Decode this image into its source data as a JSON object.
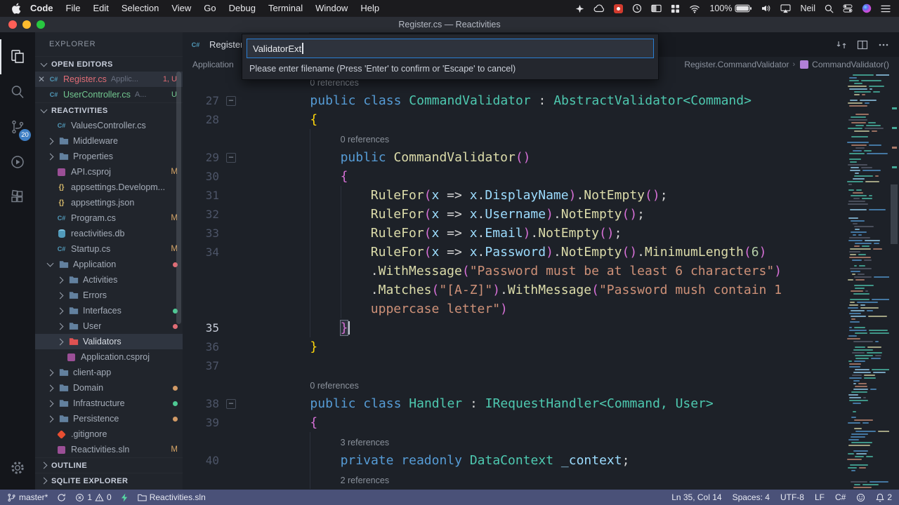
{
  "menubar": {
    "items": [
      "Code",
      "File",
      "Edit",
      "Selection",
      "View",
      "Go",
      "Debug",
      "Terminal",
      "Window",
      "Help"
    ],
    "status": {
      "battery_pct": "100%",
      "user": "Neil"
    },
    "status_icons": [
      "sparkle-icon",
      "cloud-icon",
      "red-app-icon",
      "clock-icon",
      "window-manager-icon",
      "grid-icon",
      "wifi-icon",
      "battery-icon",
      "volume-icon",
      "airplay-icon",
      "user-name",
      "search-icon",
      "control-center-icon",
      "siri-icon",
      "menu-list-icon"
    ]
  },
  "titlebar": {
    "title": "Register.cs — Reactivities"
  },
  "activitybar": {
    "scm_badge": "20"
  },
  "sidebar": {
    "header": "EXPLORER",
    "open_editors": {
      "header": "OPEN EDITORS",
      "items": [
        {
          "name": "Register.cs",
          "detail": "Applic...",
          "badge": "1, U",
          "color": "red",
          "active": true,
          "icon": "cs"
        },
        {
          "name": "UserController.cs",
          "detail": "A...",
          "badge": "U",
          "color": "green",
          "active": false,
          "icon": "cs"
        }
      ]
    },
    "project": {
      "header": "REACTIVITIES",
      "items": [
        {
          "icon": "cs",
          "label": "ValuesController.cs",
          "lvl": 0
        },
        {
          "icon": "folder",
          "chev": "r",
          "label": "Middleware",
          "lvl": 0
        },
        {
          "icon": "folder",
          "chev": "r",
          "label": "Properties",
          "lvl": 0
        },
        {
          "icon": "csproj",
          "label": "API.csproj",
          "lvl": 0,
          "badge": "M"
        },
        {
          "icon": "json",
          "label": "appsettings.Developm...",
          "lvl": 0
        },
        {
          "icon": "json",
          "label": "appsettings.json",
          "lvl": 0
        },
        {
          "icon": "cs",
          "label": "Program.cs",
          "lvl": 0,
          "badge": "M"
        },
        {
          "icon": "db",
          "label": "reactivities.db",
          "lvl": 0
        },
        {
          "icon": "cs",
          "label": "Startup.cs",
          "lvl": 0,
          "badge": "M"
        },
        {
          "icon": "folder",
          "chev": "d",
          "label": "Application",
          "lvl": 0,
          "dot": "red"
        },
        {
          "icon": "folder",
          "chev": "r",
          "label": "Activities",
          "lvl": 1
        },
        {
          "icon": "folder",
          "chev": "r",
          "label": "Errors",
          "lvl": 1
        },
        {
          "icon": "folder",
          "chev": "r",
          "label": "Interfaces",
          "lvl": 1,
          "dot": "green"
        },
        {
          "icon": "folder",
          "chev": "r",
          "label": "User",
          "lvl": 1,
          "dot": "red"
        },
        {
          "icon": "folder-red",
          "chev": "r",
          "label": "Validators",
          "lvl": 1,
          "selected": true
        },
        {
          "icon": "csproj",
          "label": "Application.csproj",
          "lvl": 1
        },
        {
          "icon": "folder",
          "chev": "r",
          "label": "client-app",
          "lvl": 0
        },
        {
          "icon": "folder",
          "chev": "r",
          "label": "Domain",
          "lvl": 0,
          "dot": "yellow"
        },
        {
          "icon": "folder",
          "chev": "r",
          "label": "Infrastructure",
          "lvl": 0,
          "dot": "green"
        },
        {
          "icon": "folder",
          "chev": "r",
          "label": "Persistence",
          "lvl": 0,
          "dot": "yellow"
        },
        {
          "icon": "git",
          "label": ".gitignore",
          "lvl": 0
        },
        {
          "icon": "sln",
          "label": "Reactivities.sln",
          "lvl": 0,
          "badge": "M"
        }
      ]
    },
    "outline_header": "OUTLINE",
    "sqlite_header": "SQLITE EXPLORER"
  },
  "quick_input": {
    "value": "ValidatorExt",
    "prompt": "Please enter filename (Press 'Enter' to confirm or 'Escape' to cancel)"
  },
  "editor": {
    "tab": {
      "label": "Register.cs"
    },
    "breadcrumbs": {
      "left": "Application",
      "type_path": "Register.CommandValidator",
      "symbol": "CommandValidator()"
    },
    "code": {
      "rows": [
        {
          "lens": "0 references",
          "ind": 8
        },
        {
          "n": "27",
          "fold": true,
          "ind": 8,
          "t": [
            [
              "k",
              "public class "
            ],
            [
              "ty",
              "CommandValidator"
            ],
            [
              "pl",
              " : "
            ],
            [
              "ty",
              "AbstractValidator<Command>"
            ]
          ]
        },
        {
          "n": "28",
          "ind": 8,
          "t": [
            [
              "b1",
              "{"
            ]
          ]
        },
        {
          "lens": "0 references",
          "ind": 12,
          "g": [
            8
          ]
        },
        {
          "n": "29",
          "fold": true,
          "ind": 12,
          "g": [
            8
          ],
          "t": [
            [
              "k",
              "public "
            ],
            [
              "fn",
              "CommandValidator"
            ],
            [
              "b2",
              "()"
            ]
          ]
        },
        {
          "n": "30",
          "ind": 12,
          "g": [
            8
          ],
          "t": [
            [
              "b2",
              "{"
            ]
          ]
        },
        {
          "n": "31",
          "ind": 16,
          "g": [
            8,
            12
          ],
          "t": [
            [
              "fn",
              "RuleFor"
            ],
            [
              "b2",
              "("
            ],
            [
              "v",
              "x"
            ],
            [
              "pl",
              " => "
            ],
            [
              "v",
              "x"
            ],
            [
              "pl",
              "."
            ],
            [
              "v",
              "DisplayName"
            ],
            [
              "b2",
              ")"
            ],
            [
              "pl",
              "."
            ],
            [
              "fn",
              "NotEmpty"
            ],
            [
              "b2",
              "()"
            ],
            [
              "pl",
              ";"
            ]
          ]
        },
        {
          "n": "32",
          "ind": 16,
          "g": [
            8,
            12
          ],
          "t": [
            [
              "fn",
              "RuleFor"
            ],
            [
              "b2",
              "("
            ],
            [
              "v",
              "x"
            ],
            [
              "pl",
              " => "
            ],
            [
              "v",
              "x"
            ],
            [
              "pl",
              "."
            ],
            [
              "v",
              "Username"
            ],
            [
              "b2",
              ")"
            ],
            [
              "pl",
              "."
            ],
            [
              "fn",
              "NotEmpty"
            ],
            [
              "b2",
              "()"
            ],
            [
              "pl",
              ";"
            ]
          ]
        },
        {
          "n": "33",
          "ind": 16,
          "g": [
            8,
            12
          ],
          "t": [
            [
              "fn",
              "RuleFor"
            ],
            [
              "b2",
              "("
            ],
            [
              "v",
              "x"
            ],
            [
              "pl",
              " => "
            ],
            [
              "v",
              "x"
            ],
            [
              "pl",
              "."
            ],
            [
              "v",
              "Email"
            ],
            [
              "b2",
              ")"
            ],
            [
              "pl",
              "."
            ],
            [
              "fn",
              "NotEmpty"
            ],
            [
              "b2",
              "()"
            ],
            [
              "pl",
              ";"
            ]
          ]
        },
        {
          "n": "34",
          "ind": 16,
          "g": [
            8,
            12
          ],
          "t": [
            [
              "fn",
              "RuleFor"
            ],
            [
              "b2",
              "("
            ],
            [
              "v",
              "x"
            ],
            [
              "pl",
              " => "
            ],
            [
              "v",
              "x"
            ],
            [
              "pl",
              "."
            ],
            [
              "v",
              "Password"
            ],
            [
              "b2",
              ")"
            ],
            [
              "pl",
              "."
            ],
            [
              "fn",
              "NotEmpty"
            ],
            [
              "b2",
              "()"
            ],
            [
              "pl",
              "."
            ],
            [
              "fn",
              "MinimumLength"
            ],
            [
              "b2",
              "("
            ],
            [
              "nu",
              "6"
            ],
            [
              "b2",
              ")"
            ]
          ]
        },
        {
          "ind": 16,
          "g": [
            8,
            12
          ],
          "t": [
            [
              "pl",
              "."
            ],
            [
              "fn",
              "WithMessage"
            ],
            [
              "b2",
              "("
            ],
            [
              "s",
              "\"Password must be at least 6 characters\""
            ],
            [
              "b2",
              ")"
            ]
          ]
        },
        {
          "ind": 16,
          "g": [
            8,
            12
          ],
          "t": [
            [
              "pl",
              "."
            ],
            [
              "fn",
              "Matches"
            ],
            [
              "b2",
              "("
            ],
            [
              "s",
              "\"[A-Z]\""
            ],
            [
              "b2",
              ")"
            ],
            [
              "pl",
              "."
            ],
            [
              "fn",
              "WithMessage"
            ],
            [
              "b2",
              "("
            ],
            [
              "s",
              "\"Password mush contain 1"
            ]
          ]
        },
        {
          "ind": 16,
          "g": [
            8,
            12
          ],
          "t": [
            [
              "s",
              "uppercase letter\""
            ],
            [
              "b2",
              ")"
            ]
          ]
        },
        {
          "n": "35",
          "ind": 12,
          "g": [
            8
          ],
          "cur": true,
          "t": [
            [
              "bm",
              "}"
            ]
          ]
        },
        {
          "n": "36",
          "ind": 8,
          "t": [
            [
              "b1",
              "}"
            ]
          ]
        },
        {
          "n": "37",
          "ind": 0,
          "t": []
        },
        {
          "lens": "0 references",
          "ind": 8
        },
        {
          "n": "38",
          "fold": true,
          "ind": 8,
          "t": [
            [
              "k",
              "public class "
            ],
            [
              "ty",
              "Handler"
            ],
            [
              "pl",
              " : "
            ],
            [
              "ty",
              "IRequestHandler<Command, User>"
            ]
          ]
        },
        {
          "n": "39",
          "ind": 8,
          "t": [
            [
              "b2",
              "{"
            ]
          ]
        },
        {
          "lens": "3 references",
          "ind": 12,
          "g": [
            8
          ]
        },
        {
          "n": "40",
          "ind": 12,
          "g": [
            8
          ],
          "t": [
            [
              "k",
              "private readonly "
            ],
            [
              "ty",
              "DataContext"
            ],
            [
              "pl",
              " "
            ],
            [
              "v",
              "_context"
            ],
            [
              "pl",
              ";"
            ]
          ]
        },
        {
          "lens": "2 references",
          "ind": 12,
          "g": [
            8
          ]
        }
      ]
    }
  },
  "statusbar": {
    "branch": "master*",
    "errors": "1",
    "warnings": "0",
    "project": "Reactivities.sln",
    "line_col": "Ln 35, Col 14",
    "spaces": "Spaces: 4",
    "encoding": "UTF-8",
    "eol": "LF",
    "language": "C#",
    "notif_count": "2"
  },
  "colors": {
    "accent_blue": "#2a7fd4",
    "statusbar_bg": "#4a5178",
    "error_red": "#e06c75",
    "untracked_green": "#73c991",
    "modified_orange": "#d8a667"
  }
}
